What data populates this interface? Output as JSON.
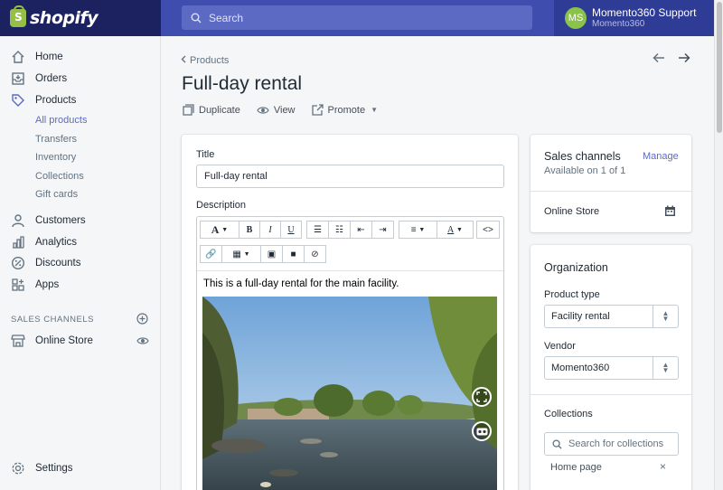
{
  "brand": {
    "name": "shopify"
  },
  "search": {
    "placeholder": "Search"
  },
  "user": {
    "initials": "MS",
    "name": "Momento360 Support",
    "store": "Momento360"
  },
  "sidebar": {
    "items": [
      {
        "label": "Home",
        "icon": "home-icon"
      },
      {
        "label": "Orders",
        "icon": "orders-icon"
      },
      {
        "label": "Products",
        "icon": "tag-icon"
      },
      {
        "label": "Customers",
        "icon": "person-icon"
      },
      {
        "label": "Analytics",
        "icon": "bar-chart-icon"
      },
      {
        "label": "Discounts",
        "icon": "discount-icon"
      },
      {
        "label": "Apps",
        "icon": "apps-icon"
      }
    ],
    "product_sub": [
      "All products",
      "Transfers",
      "Inventory",
      "Collections",
      "Gift cards"
    ],
    "sales_channels_label": "SALES CHANNELS",
    "online_store": "Online Store",
    "settings": "Settings"
  },
  "page": {
    "breadcrumb": "Products",
    "title": "Full-day rental",
    "actions": {
      "duplicate": "Duplicate",
      "view": "View",
      "promote": "Promote"
    }
  },
  "form": {
    "title_label": "Title",
    "title_value": "Full-day rental",
    "description_label": "Description",
    "description_text": "This is a full-day rental for the main facility."
  },
  "sales_channels": {
    "title": "Sales channels",
    "manage": "Manage",
    "available": "Available on 1 of 1",
    "channel": "Online Store"
  },
  "organization": {
    "title": "Organization",
    "product_type_label": "Product type",
    "product_type_value": "Facility rental",
    "vendor_label": "Vendor",
    "vendor_value": "Momento360",
    "collections_label": "Collections",
    "collections_placeholder": "Search for collections",
    "collection_tag": "Home page"
  },
  "colors": {
    "accent": "#5c6ac4",
    "topbar": "#1c2260",
    "avatar": "#8bc34a"
  }
}
